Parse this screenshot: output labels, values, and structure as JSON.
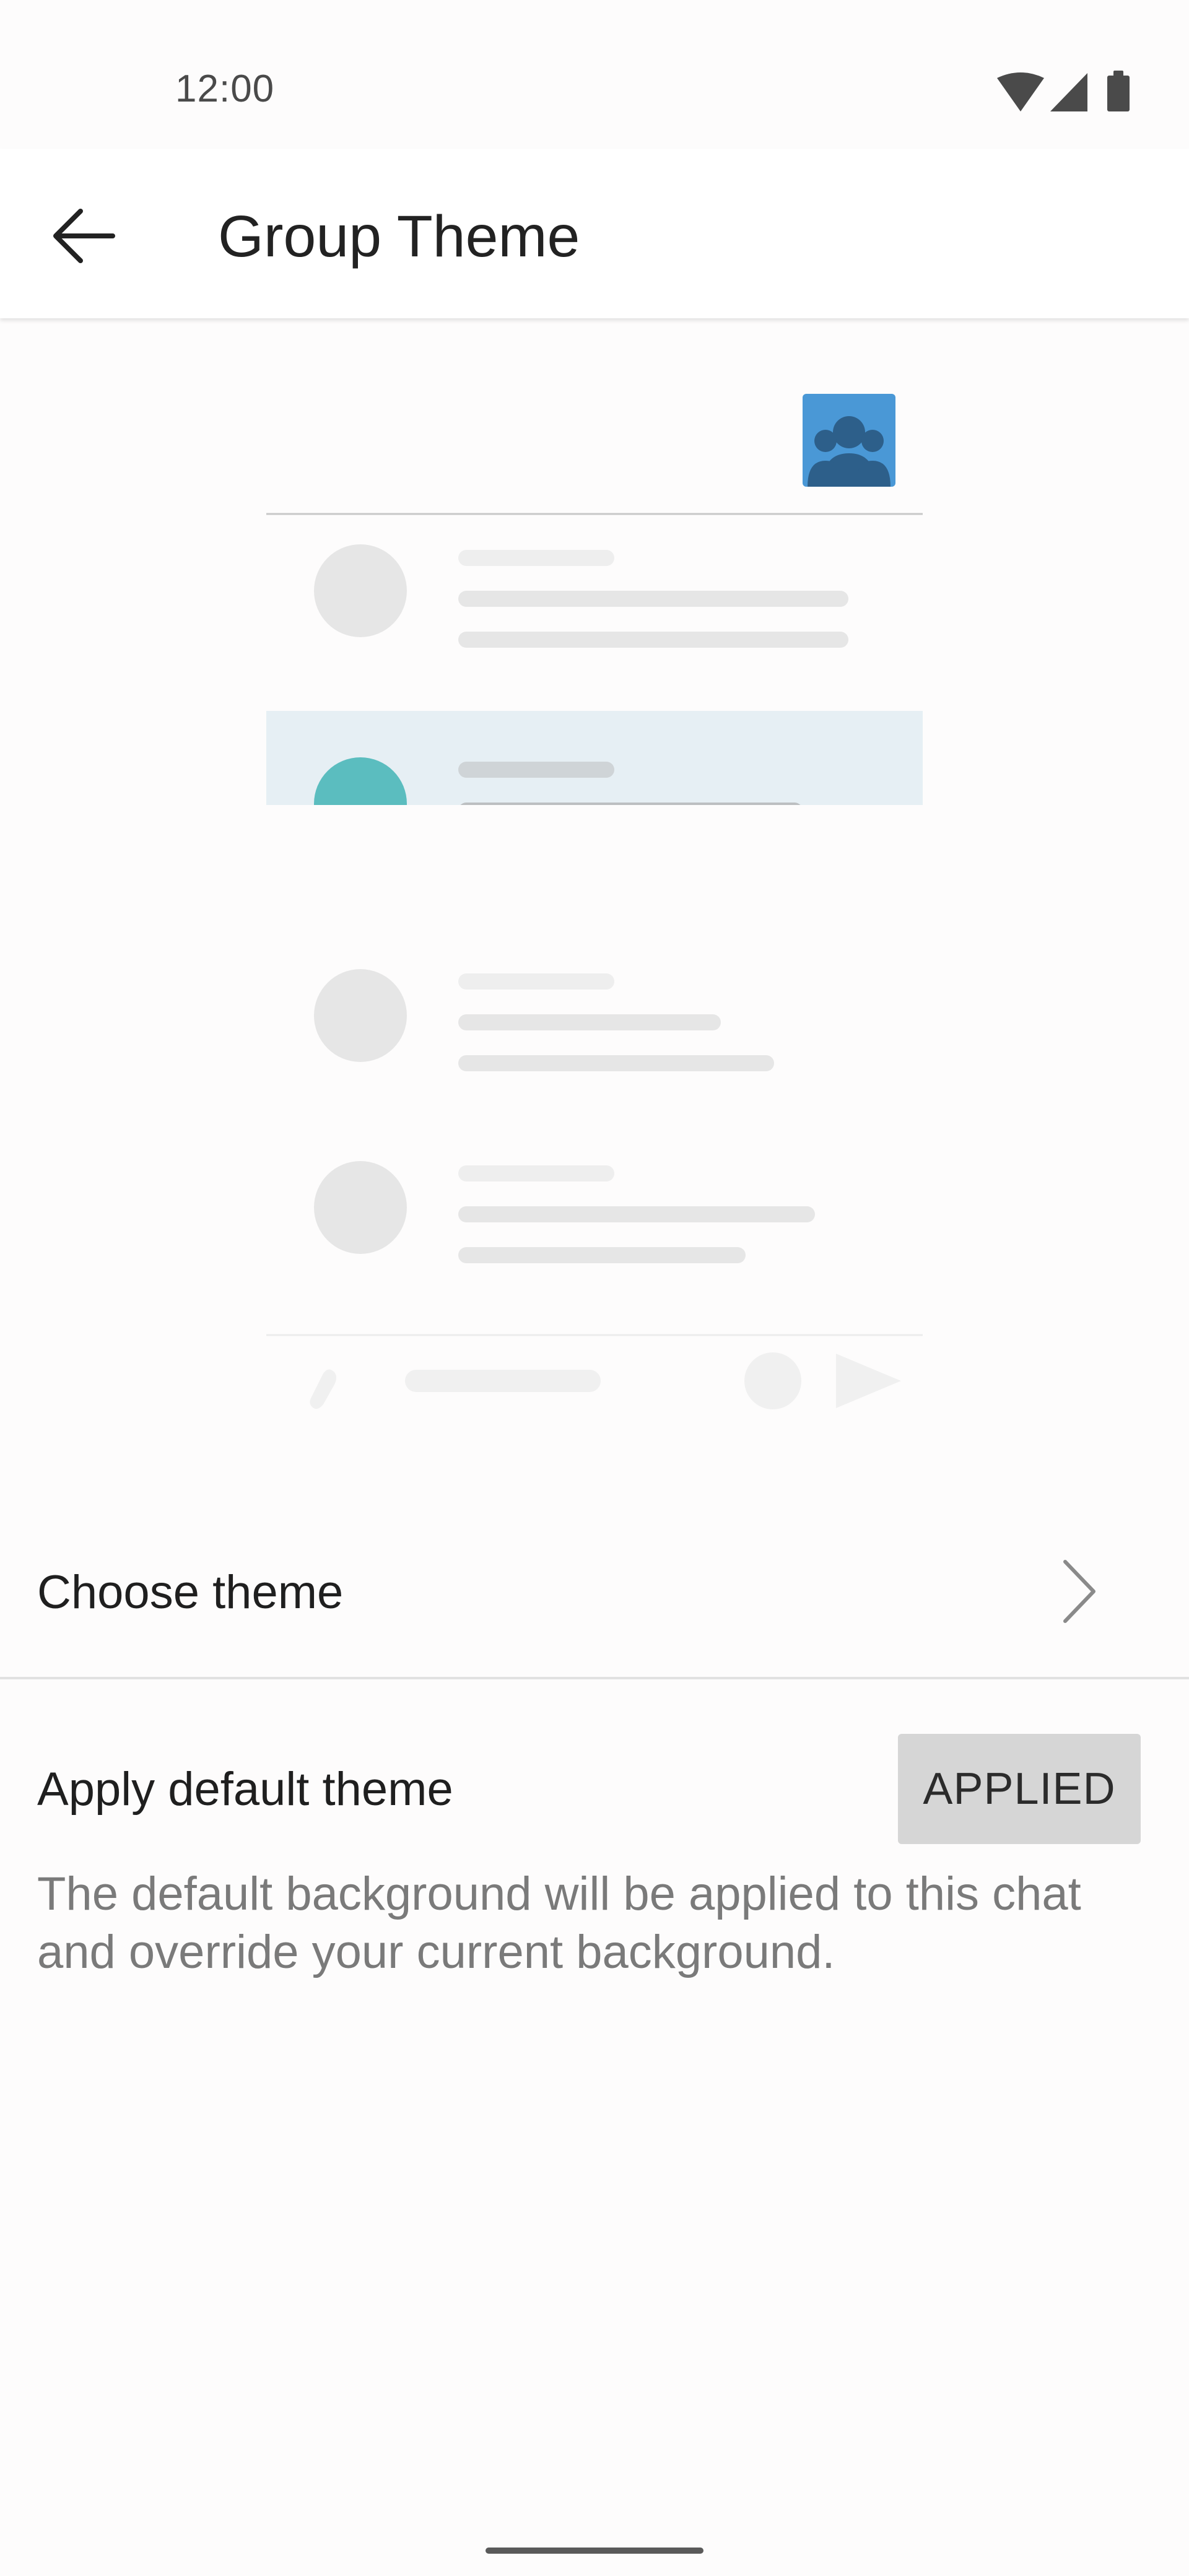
{
  "status_bar": {
    "time": "12:00",
    "icons": [
      "wifi-icon",
      "cellular-signal-icon",
      "battery-icon"
    ]
  },
  "app_bar": {
    "back_icon": "arrow-back-icon",
    "title": "Group Theme"
  },
  "preview": {
    "avatar_icon": "group-people-icon",
    "avatar_color": "#4a98d6",
    "highlight_color": "#e6eff4",
    "accent_dot_color": "#5bbdbf"
  },
  "choose_theme": {
    "label": "Choose theme",
    "icon": "chevron-right-icon"
  },
  "default_theme": {
    "label": "Apply default theme",
    "button_label": "APPLIED",
    "description": "The default background will be applied to this chat and override your current background."
  }
}
